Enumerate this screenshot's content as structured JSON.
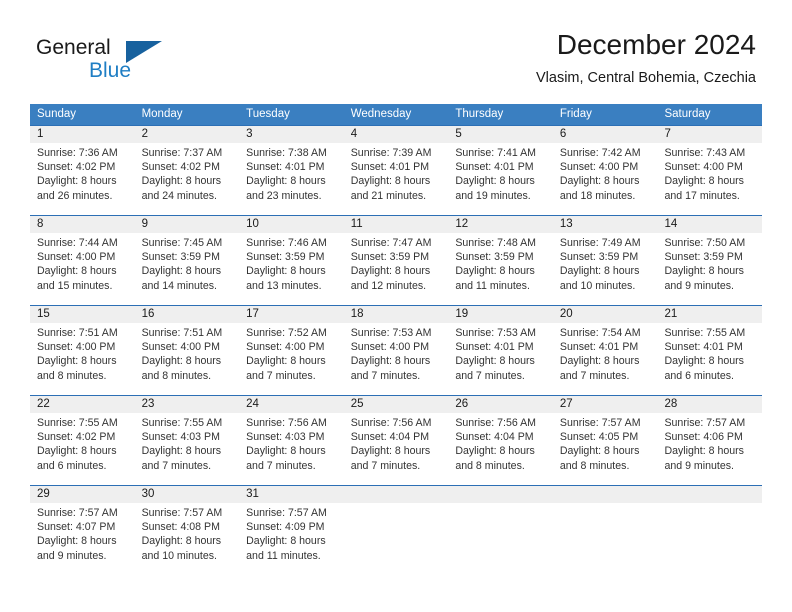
{
  "brand": {
    "word_one": "General",
    "word_two": "Blue",
    "logo_icon": "triangle-logo-icon",
    "accent_color": "#17619e",
    "blue_text_color": "#1f7ec4"
  },
  "header": {
    "title": "December 2024",
    "subtitle": "Vlasim, Central Bohemia, Czechia"
  },
  "theme": {
    "header_row_bg": "#3a7fc1",
    "week_divider": "#2c6fb5",
    "date_band_bg": "#efefef"
  },
  "weekday_headers": [
    "Sunday",
    "Monday",
    "Tuesday",
    "Wednesday",
    "Thursday",
    "Friday",
    "Saturday"
  ],
  "weeks": [
    {
      "days": [
        {
          "num": "1",
          "sunrise": "Sunrise: 7:36 AM",
          "sunset": "Sunset: 4:02 PM",
          "daylight_line1": "Daylight: 8 hours",
          "daylight_line2": "and 26 minutes."
        },
        {
          "num": "2",
          "sunrise": "Sunrise: 7:37 AM",
          "sunset": "Sunset: 4:02 PM",
          "daylight_line1": "Daylight: 8 hours",
          "daylight_line2": "and 24 minutes."
        },
        {
          "num": "3",
          "sunrise": "Sunrise: 7:38 AM",
          "sunset": "Sunset: 4:01 PM",
          "daylight_line1": "Daylight: 8 hours",
          "daylight_line2": "and 23 minutes."
        },
        {
          "num": "4",
          "sunrise": "Sunrise: 7:39 AM",
          "sunset": "Sunset: 4:01 PM",
          "daylight_line1": "Daylight: 8 hours",
          "daylight_line2": "and 21 minutes."
        },
        {
          "num": "5",
          "sunrise": "Sunrise: 7:41 AM",
          "sunset": "Sunset: 4:01 PM",
          "daylight_line1": "Daylight: 8 hours",
          "daylight_line2": "and 19 minutes."
        },
        {
          "num": "6",
          "sunrise": "Sunrise: 7:42 AM",
          "sunset": "Sunset: 4:00 PM",
          "daylight_line1": "Daylight: 8 hours",
          "daylight_line2": "and 18 minutes."
        },
        {
          "num": "7",
          "sunrise": "Sunrise: 7:43 AM",
          "sunset": "Sunset: 4:00 PM",
          "daylight_line1": "Daylight: 8 hours",
          "daylight_line2": "and 17 minutes."
        }
      ]
    },
    {
      "days": [
        {
          "num": "8",
          "sunrise": "Sunrise: 7:44 AM",
          "sunset": "Sunset: 4:00 PM",
          "daylight_line1": "Daylight: 8 hours",
          "daylight_line2": "and 15 minutes."
        },
        {
          "num": "9",
          "sunrise": "Sunrise: 7:45 AM",
          "sunset": "Sunset: 3:59 PM",
          "daylight_line1": "Daylight: 8 hours",
          "daylight_line2": "and 14 minutes."
        },
        {
          "num": "10",
          "sunrise": "Sunrise: 7:46 AM",
          "sunset": "Sunset: 3:59 PM",
          "daylight_line1": "Daylight: 8 hours",
          "daylight_line2": "and 13 minutes."
        },
        {
          "num": "11",
          "sunrise": "Sunrise: 7:47 AM",
          "sunset": "Sunset: 3:59 PM",
          "daylight_line1": "Daylight: 8 hours",
          "daylight_line2": "and 12 minutes."
        },
        {
          "num": "12",
          "sunrise": "Sunrise: 7:48 AM",
          "sunset": "Sunset: 3:59 PM",
          "daylight_line1": "Daylight: 8 hours",
          "daylight_line2": "and 11 minutes."
        },
        {
          "num": "13",
          "sunrise": "Sunrise: 7:49 AM",
          "sunset": "Sunset: 3:59 PM",
          "daylight_line1": "Daylight: 8 hours",
          "daylight_line2": "and 10 minutes."
        },
        {
          "num": "14",
          "sunrise": "Sunrise: 7:50 AM",
          "sunset": "Sunset: 3:59 PM",
          "daylight_line1": "Daylight: 8 hours",
          "daylight_line2": "and 9 minutes."
        }
      ]
    },
    {
      "days": [
        {
          "num": "15",
          "sunrise": "Sunrise: 7:51 AM",
          "sunset": "Sunset: 4:00 PM",
          "daylight_line1": "Daylight: 8 hours",
          "daylight_line2": "and 8 minutes."
        },
        {
          "num": "16",
          "sunrise": "Sunrise: 7:51 AM",
          "sunset": "Sunset: 4:00 PM",
          "daylight_line1": "Daylight: 8 hours",
          "daylight_line2": "and 8 minutes."
        },
        {
          "num": "17",
          "sunrise": "Sunrise: 7:52 AM",
          "sunset": "Sunset: 4:00 PM",
          "daylight_line1": "Daylight: 8 hours",
          "daylight_line2": "and 7 minutes."
        },
        {
          "num": "18",
          "sunrise": "Sunrise: 7:53 AM",
          "sunset": "Sunset: 4:00 PM",
          "daylight_line1": "Daylight: 8 hours",
          "daylight_line2": "and 7 minutes."
        },
        {
          "num": "19",
          "sunrise": "Sunrise: 7:53 AM",
          "sunset": "Sunset: 4:01 PM",
          "daylight_line1": "Daylight: 8 hours",
          "daylight_line2": "and 7 minutes."
        },
        {
          "num": "20",
          "sunrise": "Sunrise: 7:54 AM",
          "sunset": "Sunset: 4:01 PM",
          "daylight_line1": "Daylight: 8 hours",
          "daylight_line2": "and 7 minutes."
        },
        {
          "num": "21",
          "sunrise": "Sunrise: 7:55 AM",
          "sunset": "Sunset: 4:01 PM",
          "daylight_line1": "Daylight: 8 hours",
          "daylight_line2": "and 6 minutes."
        }
      ]
    },
    {
      "days": [
        {
          "num": "22",
          "sunrise": "Sunrise: 7:55 AM",
          "sunset": "Sunset: 4:02 PM",
          "daylight_line1": "Daylight: 8 hours",
          "daylight_line2": "and 6 minutes."
        },
        {
          "num": "23",
          "sunrise": "Sunrise: 7:55 AM",
          "sunset": "Sunset: 4:03 PM",
          "daylight_line1": "Daylight: 8 hours",
          "daylight_line2": "and 7 minutes."
        },
        {
          "num": "24",
          "sunrise": "Sunrise: 7:56 AM",
          "sunset": "Sunset: 4:03 PM",
          "daylight_line1": "Daylight: 8 hours",
          "daylight_line2": "and 7 minutes."
        },
        {
          "num": "25",
          "sunrise": "Sunrise: 7:56 AM",
          "sunset": "Sunset: 4:04 PM",
          "daylight_line1": "Daylight: 8 hours",
          "daylight_line2": "and 7 minutes."
        },
        {
          "num": "26",
          "sunrise": "Sunrise: 7:56 AM",
          "sunset": "Sunset: 4:04 PM",
          "daylight_line1": "Daylight: 8 hours",
          "daylight_line2": "and 8 minutes."
        },
        {
          "num": "27",
          "sunrise": "Sunrise: 7:57 AM",
          "sunset": "Sunset: 4:05 PM",
          "daylight_line1": "Daylight: 8 hours",
          "daylight_line2": "and 8 minutes."
        },
        {
          "num": "28",
          "sunrise": "Sunrise: 7:57 AM",
          "sunset": "Sunset: 4:06 PM",
          "daylight_line1": "Daylight: 8 hours",
          "daylight_line2": "and 9 minutes."
        }
      ]
    },
    {
      "days": [
        {
          "num": "29",
          "sunrise": "Sunrise: 7:57 AM",
          "sunset": "Sunset: 4:07 PM",
          "daylight_line1": "Daylight: 8 hours",
          "daylight_line2": "and 9 minutes."
        },
        {
          "num": "30",
          "sunrise": "Sunrise: 7:57 AM",
          "sunset": "Sunset: 4:08 PM",
          "daylight_line1": "Daylight: 8 hours",
          "daylight_line2": "and 10 minutes."
        },
        {
          "num": "31",
          "sunrise": "Sunrise: 7:57 AM",
          "sunset": "Sunset: 4:09 PM",
          "daylight_line1": "Daylight: 8 hours",
          "daylight_line2": "and 11 minutes."
        },
        {
          "num": "",
          "sunrise": "",
          "sunset": "",
          "daylight_line1": "",
          "daylight_line2": ""
        },
        {
          "num": "",
          "sunrise": "",
          "sunset": "",
          "daylight_line1": "",
          "daylight_line2": ""
        },
        {
          "num": "",
          "sunrise": "",
          "sunset": "",
          "daylight_line1": "",
          "daylight_line2": ""
        },
        {
          "num": "",
          "sunrise": "",
          "sunset": "",
          "daylight_line1": "",
          "daylight_line2": ""
        }
      ]
    }
  ]
}
